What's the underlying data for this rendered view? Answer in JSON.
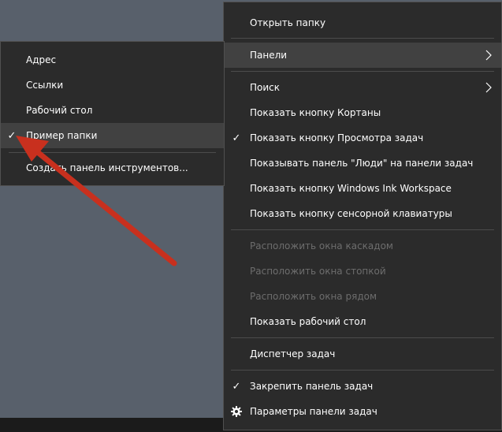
{
  "main_menu": {
    "open_folder": "Открыть папку",
    "panels": "Панели",
    "search": "Поиск",
    "show_cortana": "Показать кнопку Кортаны",
    "show_task_view": "Показать кнопку Просмотра задач",
    "show_people": "Показывать панель \"Люди\" на панели задач",
    "show_ink": "Показать кнопку Windows Ink Workspace",
    "show_keyboard": "Показать кнопку сенсорной клавиатуры",
    "cascade": "Расположить окна каскадом",
    "stack": "Расположить окна стопкой",
    "side_by_side": "Расположить окна рядом",
    "show_desktop": "Показать рабочий стол",
    "task_manager": "Диспетчер задач",
    "lock_taskbar": "Закрепить панель задач",
    "taskbar_settings": "Параметры панели задач"
  },
  "sub_menu": {
    "address": "Адрес",
    "links": "Ссылки",
    "desktop": "Рабочий стол",
    "example_folder": "Пример папки",
    "new_toolbar": "Создать панель инструментов..."
  },
  "glyphs": {
    "check": "✓"
  },
  "colors": {
    "desktop": "#58606b",
    "menu_bg": "#2b2b2b",
    "highlight": "#414141",
    "disabled_text": "#6d6d6d",
    "annotation_arrow": "#c8301e"
  }
}
